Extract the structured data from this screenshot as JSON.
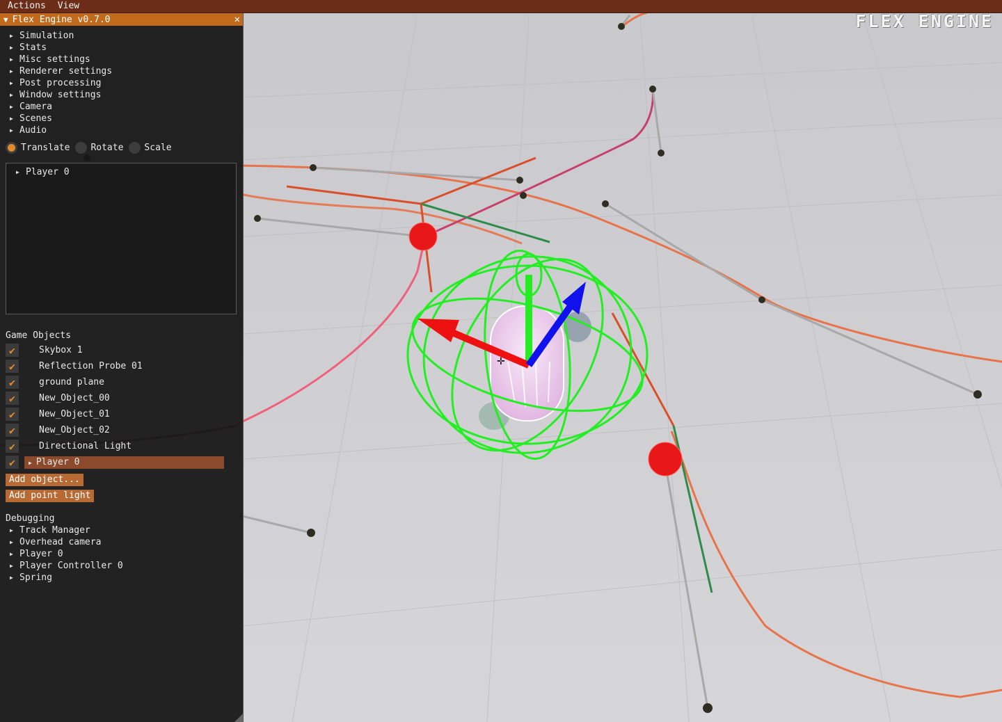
{
  "menu": {
    "items": [
      {
        "label": "Actions"
      },
      {
        "label": "View"
      }
    ]
  },
  "logo": "FLEX ENGINE",
  "panel": {
    "title": "Flex Engine v0.7.0",
    "close_glyph": "✕",
    "sections": [
      "Simulation",
      "Stats",
      "Misc settings",
      "Renderer settings",
      "Post processing",
      "Window settings",
      "Camera",
      "Scenes",
      "Audio"
    ],
    "gizmo_modes": [
      {
        "label": "Translate",
        "selected": true
      },
      {
        "label": "Rotate",
        "selected": false
      },
      {
        "label": "Scale",
        "selected": false
      }
    ],
    "hierarchy": {
      "items": [
        "Player 0"
      ]
    },
    "game_objects": {
      "title": "Game Objects",
      "items": [
        {
          "label": "Skybox 1",
          "checked": true
        },
        {
          "label": "Reflection Probe 01",
          "checked": true
        },
        {
          "label": "ground plane",
          "checked": true
        },
        {
          "label": "New_Object_00",
          "checked": true
        },
        {
          "label": "New_Object_01",
          "checked": true
        },
        {
          "label": "New_Object_02",
          "checked": true
        },
        {
          "label": "Directional Light",
          "checked": true
        },
        {
          "label": "Player 0",
          "checked": true,
          "selected": true
        }
      ]
    },
    "buttons": {
      "add_object": "Add object...",
      "add_point_light": "Add point light"
    },
    "debugging": {
      "title": "Debugging",
      "items": [
        "Track Manager",
        "Overhead camera",
        "Player 0",
        "Player Controller 0",
        "Spring"
      ]
    }
  },
  "colors": {
    "menubar": "#6b2d18",
    "panel_title": "#c26a1c",
    "accent": "#e08a2c",
    "selection": "#8c4a2c",
    "button": "#b86a35",
    "ground": "#cfcfd3",
    "track_orange": "#e8734a",
    "gizmo_green": "#22ee22",
    "gizmo_red": "#ee1111",
    "gizmo_blue": "#1111ee"
  }
}
